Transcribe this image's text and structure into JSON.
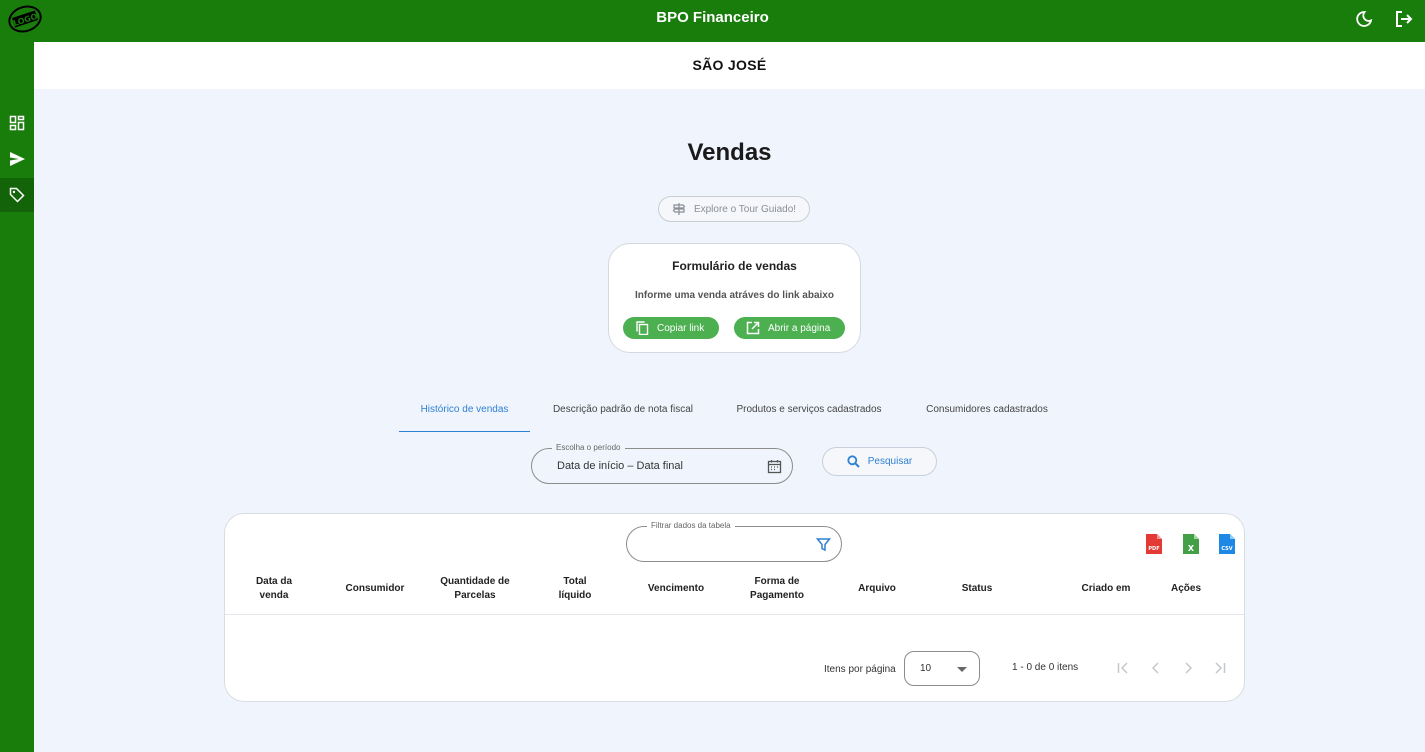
{
  "header": {
    "title": "BPO Financeiro",
    "logo_text": "LOGO"
  },
  "company": {
    "name": "SÃO JOSÉ"
  },
  "page": {
    "title": "Vendas",
    "tour_label": "Explore o Tour Guiado!"
  },
  "form_card": {
    "title": "Formulário de vendas",
    "description": "Informe uma venda atráves do link abaixo",
    "copy_label": "Copiar link",
    "open_label": "Abrir a página"
  },
  "tabs": [
    {
      "label": "Histórico de vendas",
      "active": true
    },
    {
      "label": "Descrição padrão de nota fiscal",
      "active": false
    },
    {
      "label": "Produtos e serviços cadastrados",
      "active": false
    },
    {
      "label": "Consumidores cadastrados",
      "active": false
    }
  ],
  "period": {
    "label": "Escolha o período",
    "start_placeholder": "Data de início",
    "separator": "–",
    "end_placeholder": "Data final"
  },
  "search": {
    "label": "Pesquisar"
  },
  "table": {
    "filter_label": "Filtrar dados da tabela",
    "filter_value": "",
    "exports": [
      "PDF",
      "X",
      "CSV"
    ],
    "columns": [
      "Data da venda",
      "Consumidor",
      "Quantidade de Parcelas",
      "Total líquido",
      "Vencimento",
      "Forma de Pagamento",
      "Arquivo",
      "Status",
      "Criado em",
      "Ações"
    ],
    "rows": []
  },
  "pagination": {
    "items_per_page_label": "Itens por página",
    "items_per_page": "10",
    "range_text": "1 - 0 de 0 itens"
  },
  "colors": {
    "brand_green": "#197d0c",
    "button_green": "#4caf50",
    "accent_blue": "#2f80d1",
    "background": "#f0f5fd"
  }
}
